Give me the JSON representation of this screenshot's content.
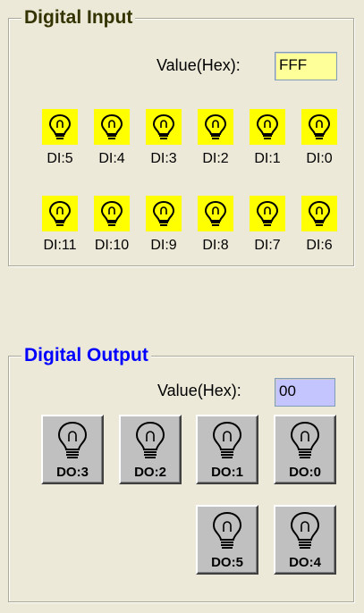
{
  "digital_input": {
    "title": "Digital Input",
    "value_label": "Value(Hex):",
    "value": "FFF",
    "row1": [
      {
        "label": "DI:5"
      },
      {
        "label": "DI:4"
      },
      {
        "label": "DI:3"
      },
      {
        "label": "DI:2"
      },
      {
        "label": "DI:1"
      },
      {
        "label": "DI:0"
      }
    ],
    "row2": [
      {
        "label": "DI:11"
      },
      {
        "label": "DI:10"
      },
      {
        "label": "DI:9"
      },
      {
        "label": "DI:8"
      },
      {
        "label": "DI:7"
      },
      {
        "label": "DI:6"
      }
    ],
    "lamp_state": "on",
    "lamp_color": "#ffff00"
  },
  "digital_output": {
    "title": "Digital Output",
    "value_label": "Value(Hex):",
    "value": "00",
    "value_bg": "#c4c4ff",
    "buttons": [
      {
        "label": "DO:3"
      },
      {
        "label": "DO:2"
      },
      {
        "label": "DO:1"
      },
      {
        "label": "DO:0"
      },
      {
        "label": "DO:5"
      },
      {
        "label": "DO:4"
      }
    ],
    "lamp_state": "off"
  },
  "colors": {
    "di_title": "#333300",
    "do_title": "#0000ff",
    "di_value_bg": "#ffff99"
  }
}
